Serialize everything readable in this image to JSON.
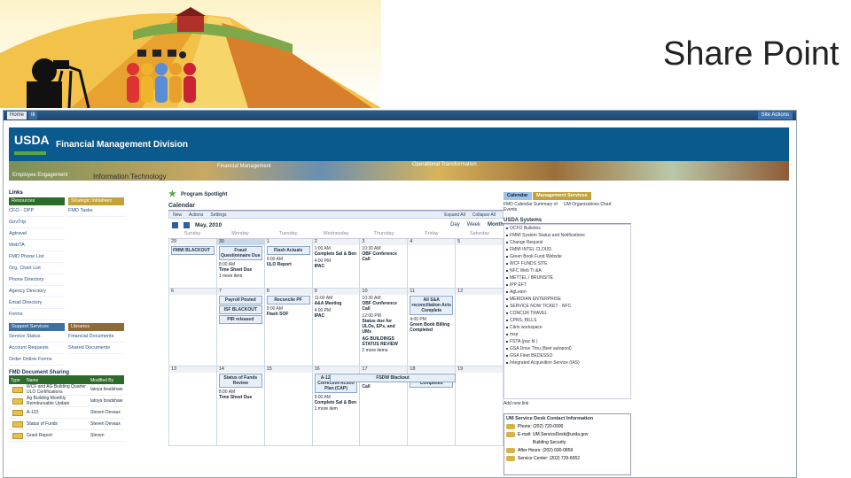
{
  "slide_title": "Share Point",
  "topbar": {
    "tabs": [
      "Home",
      "Ill"
    ],
    "site_actions": "Site Actions"
  },
  "header": {
    "logo": "USDA",
    "title": "Financial Management Division"
  },
  "strip": {
    "captions": [
      "Financial Management",
      "Operational Transformation",
      "Employee Engagement",
      "Information Technology"
    ]
  },
  "left": {
    "links_label": "Links",
    "col_heads": [
      "Resources",
      "Strategic Initiatives"
    ],
    "resources": [
      "CFO - OPP",
      "GovTrip",
      "Agtravel",
      "WebTA",
      "FMD Phone List",
      "Org. Chart List",
      "Phone Directory",
      "Agency Directory",
      "Email Directory",
      "Forms"
    ],
    "strategic": [
      "FMD Tasks"
    ],
    "support_heads": [
      "Support Services",
      "Libraries"
    ],
    "support": [
      "Service Status",
      "Account Requests",
      "Order Online Forms"
    ],
    "libraries": [
      "Financial Documents",
      "Shared Documents"
    ],
    "doc_sharing_label": "FMD Document Sharing",
    "doc_cols": [
      "Type",
      "Name",
      "Modified By"
    ],
    "docs": [
      {
        "name": "WCF and AG Building Quarter ULO Certifications",
        "by": "latoya bradshaw"
      },
      {
        "name": "Ag Building Monthly Reimbursable Update",
        "by": "latoya bradshaw"
      },
      {
        "name": "A-123",
        "by": "Steven Devaux"
      },
      {
        "name": "Status of Funds",
        "by": "Steven Devaux"
      },
      {
        "name": "Grant Report",
        "by": "Steven"
      }
    ]
  },
  "center": {
    "spotlight": "Program Spotlight",
    "calendar_label": "Calendar",
    "toolbar": [
      "New",
      "Actions",
      "Settings",
      "Expand All",
      "Collapse All"
    ],
    "month": "May, 2010",
    "views": [
      "Day",
      "Week",
      "Month"
    ],
    "weekdays": [
      "Sunday",
      "Monday",
      "Tuesday",
      "Wednesday",
      "Thursday",
      "Friday",
      "Saturday"
    ],
    "weeks": [
      {
        "days": [
          "29",
          "30",
          "1",
          "2",
          "3",
          "4",
          "5"
        ],
        "span": "FMMI BLACKOUT",
        "cells": [
          [],
          [
            {
              "box": "Fraud Questionnaire Due"
            },
            {
              "time": "8:00 AM",
              "text": "Time Sheet Due"
            },
            {
              "more": "1 more item"
            }
          ],
          [
            {
              "box": "Flash Actuals"
            },
            {
              "time": "9:00 AM",
              "text": "ULO Report"
            }
          ],
          [
            {
              "time": "1:00 AM",
              "text": "Complete Sal & Ben"
            },
            {
              "time": "4:00 PM",
              "text": "IPAC"
            }
          ],
          [
            {
              "time": "10:30 AM",
              "text": "OBF Conference Call"
            }
          ],
          [],
          []
        ]
      },
      {
        "days": [
          "6",
          "7",
          "8",
          "9",
          "10",
          "11",
          "12"
        ],
        "span": "",
        "cells": [
          [],
          [
            {
              "box": "Payroll Posted"
            },
            {
              "box": "ISF BLACKOUT"
            },
            {
              "box": "PIR released"
            }
          ],
          [
            {
              "box": "Reconcile PF"
            },
            {
              "time": "9:00 AM",
              "text": "Flash SOF"
            }
          ],
          [
            {
              "time": "11:00 AM",
              "text": "A&A Meeting"
            },
            {
              "time": "4:00 PM",
              "text": "IPAC"
            }
          ],
          [
            {
              "time": "10:30 AM",
              "text": "OBF Conference Call"
            },
            {
              "time": "12:00 PM",
              "text": "Status due for ULOs, EPs, and UMs"
            },
            {
              "text": "AG BUILDINGS STATUS REVIEW"
            },
            {
              "more": "2 more items"
            }
          ],
          [
            {
              "box": "All S&A reconciliation Acts Complete"
            },
            {
              "time": "4:00 PM",
              "text": "Green Book Billing Completed"
            }
          ],
          []
        ]
      },
      {
        "days": [
          "13",
          "14",
          "15",
          "16",
          "17",
          "18",
          "19"
        ],
        "span": "FSDW Blackout",
        "cells": [
          [],
          [
            {
              "box": "Status of Funds Review"
            },
            {
              "time": "8:00 AM",
              "text": "Time Sheet Due"
            }
          ],
          [],
          [
            {
              "box": "A-123 Training Corrective Action Plan (CAP)"
            },
            {
              "time": "9:00 AM",
              "text": "Complete Sal & Ben"
            },
            {
              "more": "1 more item"
            }
          ],
          [
            {
              "time": "10:30 AM",
              "text": "OBF Conference Call"
            }
          ],
          [
            {
              "box": "SoF Package Completed"
            }
          ],
          []
        ]
      }
    ]
  },
  "right": {
    "tabs": [
      "Calendar",
      "Management Services"
    ],
    "calendar_links": [
      "FMD Calendar Summary of Events"
    ],
    "mgmt_links": [
      "UM Organizations Chart"
    ],
    "systems_label": "USDA Systems",
    "systems": [
      "OCFO Bulletins",
      "FMMI System Status and Notifications",
      "Change Request",
      "FMMI INTEL CLOUD",
      "Green Book Fund Website",
      "WCF FUNDS SITE",
      "NFC Web TI &A",
      "METTEL / BRUNSITE",
      "IPP EFT",
      "AgLearn",
      "MERIDIAN ENTERPRISE",
      "SERVICE NOW TICKET - NFC",
      "CONCUR TRAVEL",
      "CPRS, BILLS",
      "Citrix workspace",
      "mxp",
      "FSTA (pac bl )",
      "GSA Drive Thru (fleet autopool)",
      "GSA Fleet BEDESSO",
      "Integrated Acquisition Service (IAS)"
    ],
    "add_link": "Add new link",
    "service_desk": {
      "title": "UM Service Desk Contact Information",
      "phone": "Phone: (202) 720-0000",
      "email": "E-mail: UM.ServiceDesk@usda.gov",
      "building": "Building Security",
      "after_hours": "After Hours: (202) 690-0859",
      "service_center": "Service Center: (202) 720-6652"
    }
  }
}
